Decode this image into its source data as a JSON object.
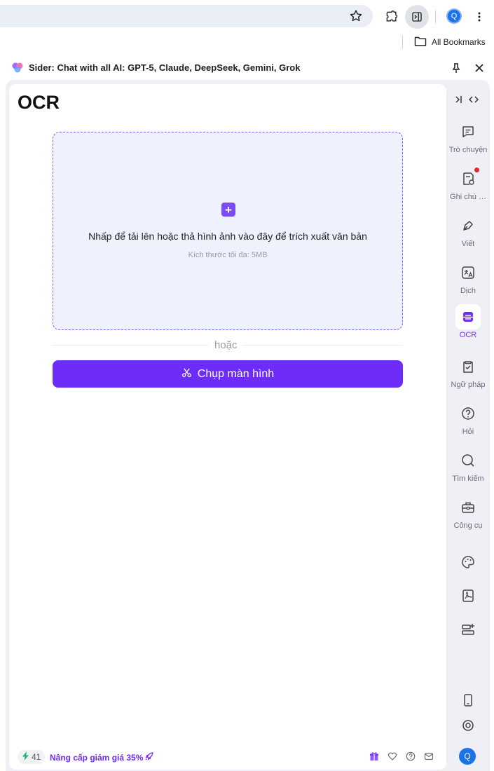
{
  "browser": {
    "avatar_letter": "Q",
    "bookmarks_label": "All Bookmarks"
  },
  "panel": {
    "title": "Sider: Chat with all AI: GPT-5, Claude, DeepSeek, Gemini, Grok"
  },
  "main": {
    "title": "OCR",
    "drop_text": "Nhấp để tải lên hoặc thả hình ảnh vào đây để trích xuất văn bản",
    "drop_sub": "Kích thước tối đa: 5MB",
    "or_text": "hoặc",
    "capture_label": "Chụp màn hình"
  },
  "footer": {
    "credits": "41",
    "upgrade": "Nâng cấp giảm giá 35%"
  },
  "rail": {
    "items": [
      {
        "label": "Trò chuyện",
        "icon": "chat-icon"
      },
      {
        "label": "Ghi chú …",
        "icon": "notes-icon"
      },
      {
        "label": "Viết",
        "icon": "write-icon"
      },
      {
        "label": "Dịch",
        "icon": "translate-icon"
      },
      {
        "label": "OCR",
        "icon": "ocr-icon"
      },
      {
        "label": "Ngữ pháp",
        "icon": "grammar-icon"
      },
      {
        "label": "Hỏi",
        "icon": "ask-icon"
      },
      {
        "label": "Tìm kiếm",
        "icon": "search-icon"
      },
      {
        "label": "Công cụ",
        "icon": "tools-icon"
      }
    ],
    "avatar_letter": "Q"
  },
  "colors": {
    "accent": "#6e2cf8",
    "dropzone_bg": "#edf2fd",
    "rail_bg": "#eef0f5"
  }
}
